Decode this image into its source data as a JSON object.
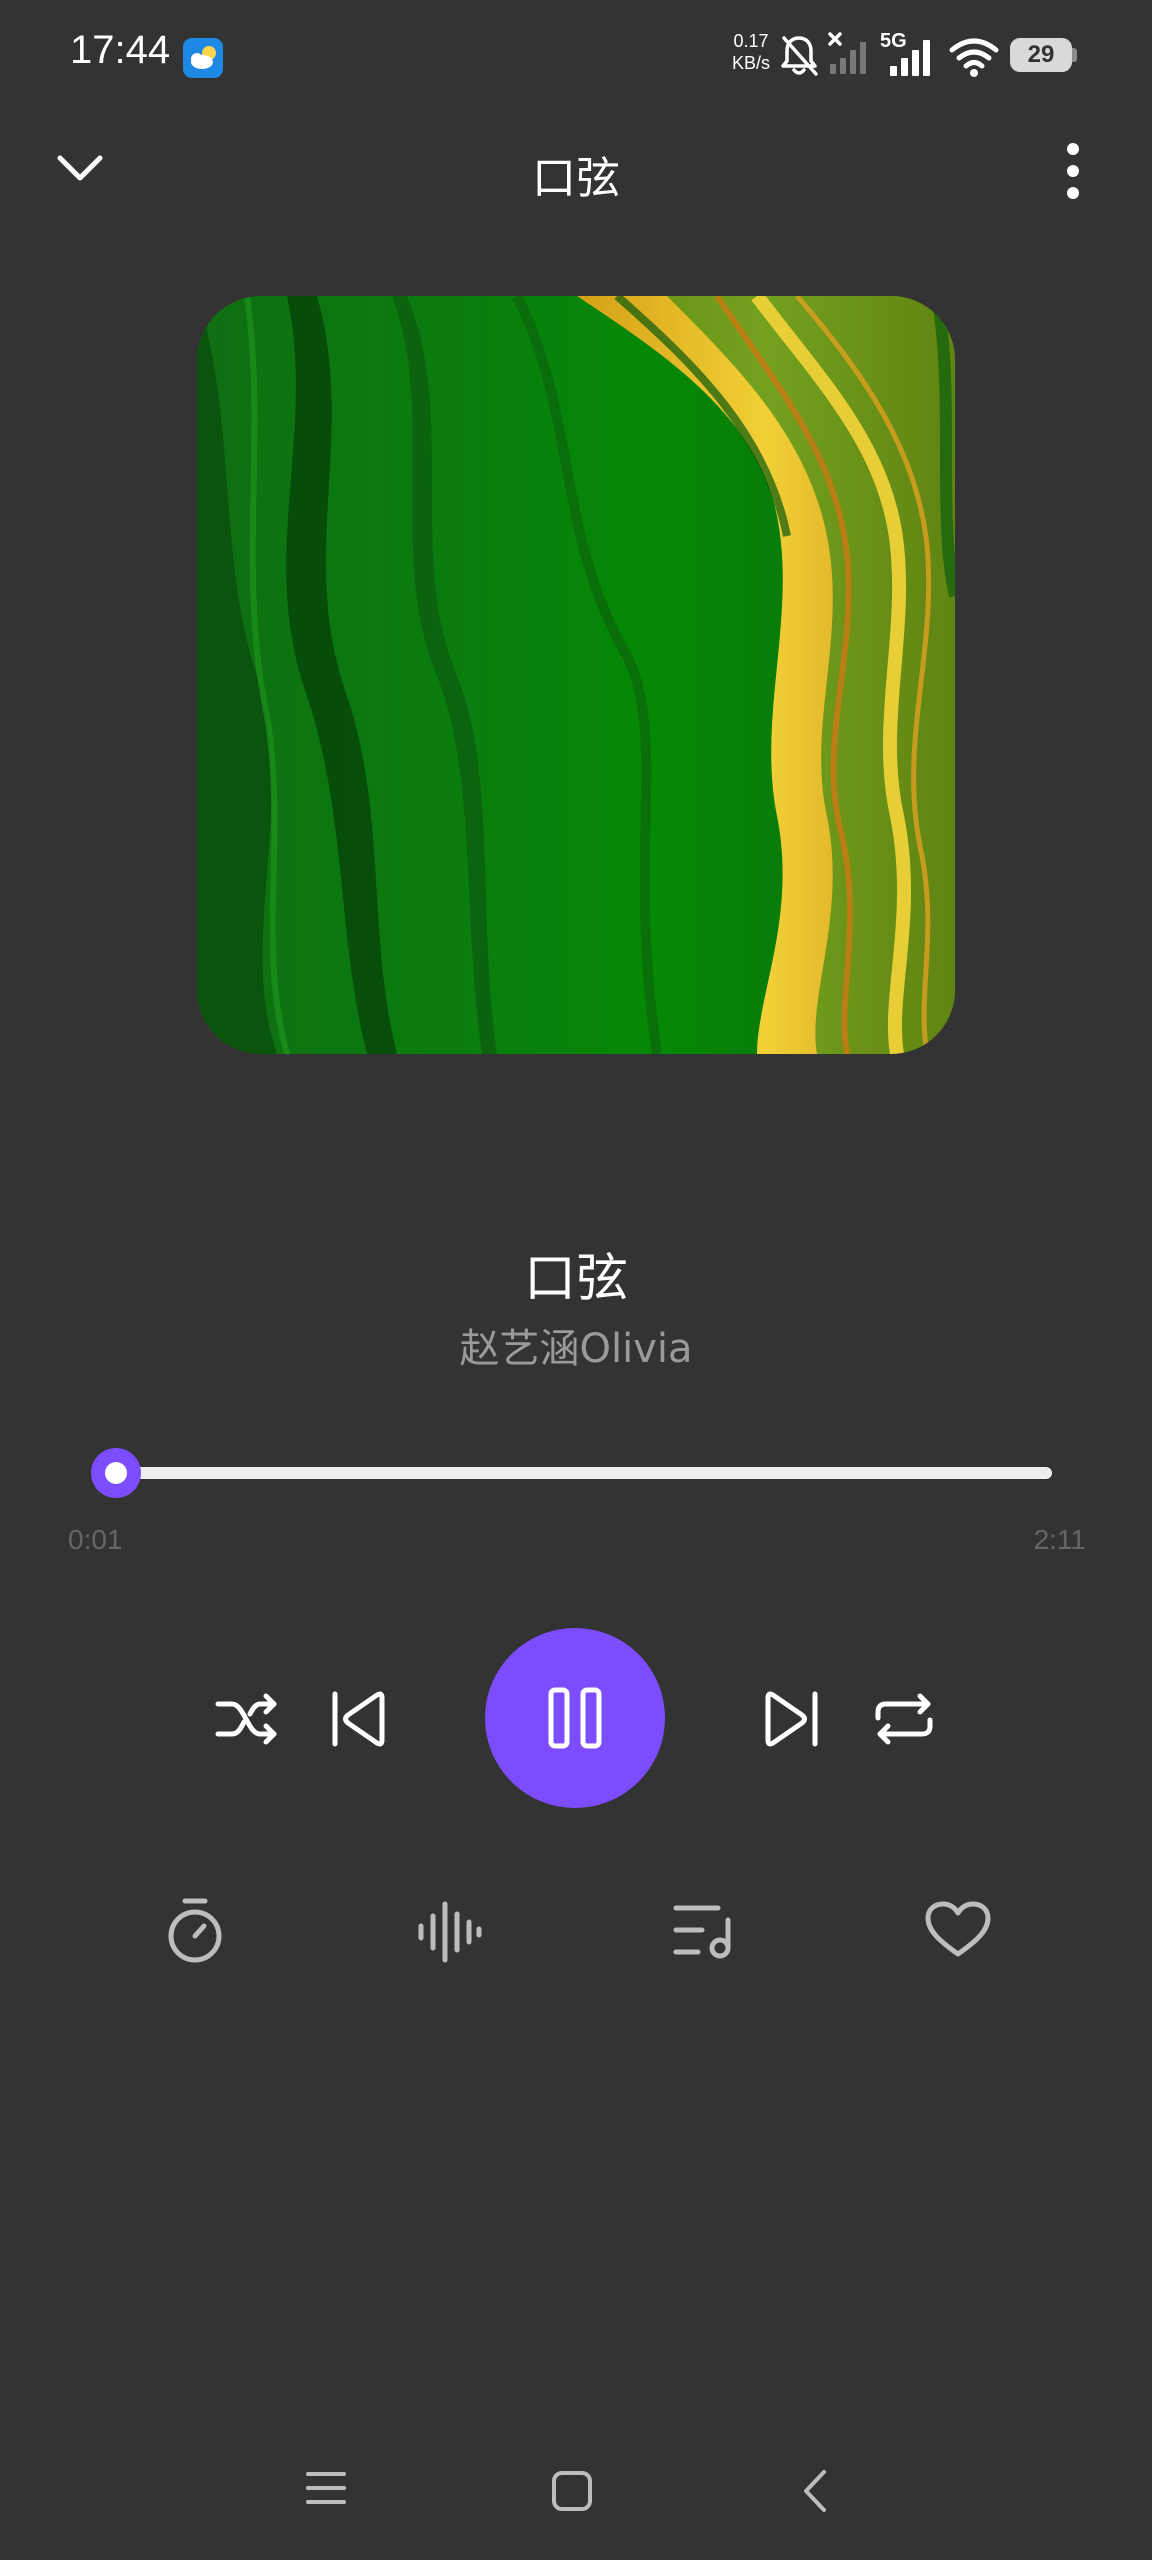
{
  "status_bar": {
    "time": "17:44",
    "net_speed_value": "0.17",
    "net_speed_unit": "KB/s",
    "network_type": "5G",
    "battery": "29",
    "icons": [
      "weather-icon",
      "bell-muted-icon",
      "signal-off-icon",
      "signal-5g-icon",
      "wifi-icon",
      "battery-icon"
    ]
  },
  "header": {
    "title": "口弦",
    "icons": [
      "chevron-down-icon",
      "more-vertical-icon"
    ]
  },
  "song": {
    "title": "口弦",
    "artist": "赵艺涵Olivia"
  },
  "progress": {
    "current": "0:01",
    "total": "2:11",
    "fraction": 0.008
  },
  "controls": {
    "icons": [
      "shuffle-icon",
      "previous-icon",
      "pause-icon",
      "next-icon",
      "repeat-icon"
    ],
    "accent_color": "#7c4dff"
  },
  "actions": {
    "icons": [
      "timer-icon",
      "audio-effect-icon",
      "playlist-icon",
      "heart-icon"
    ]
  },
  "colors": {
    "background": "#333333",
    "accent": "#7c4dff",
    "secondary_text": "#9a9a9a"
  }
}
